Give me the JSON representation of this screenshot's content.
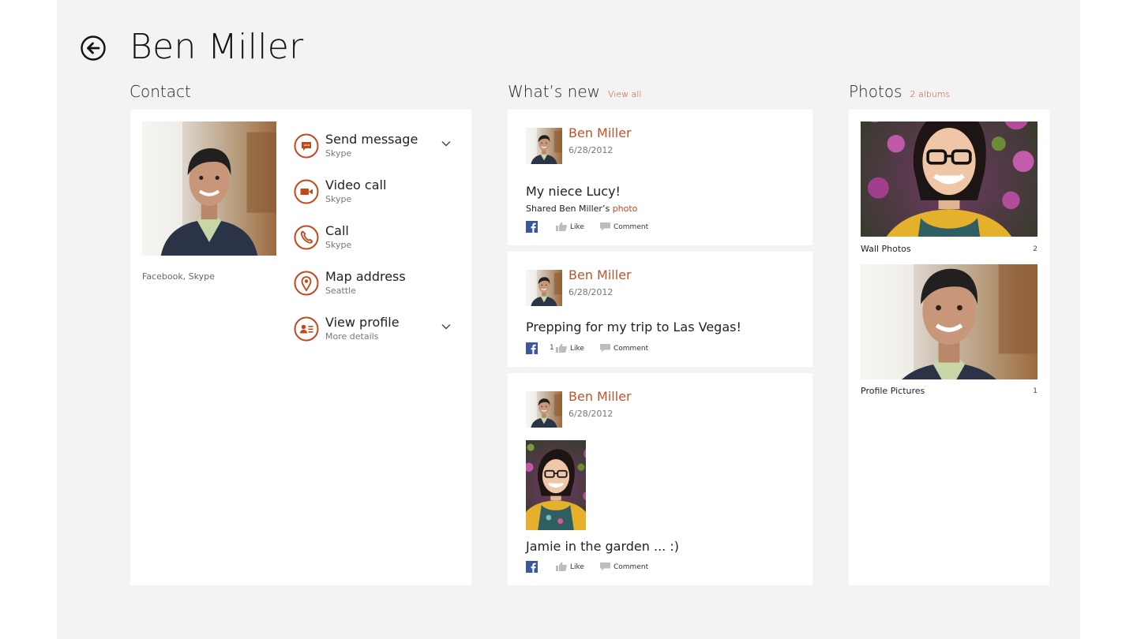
{
  "title": "Ben Miller",
  "contact": {
    "heading": "Contact",
    "sources": "Facebook, Skype",
    "actions": [
      {
        "label": "Send message",
        "sub": "Skype"
      },
      {
        "label": "Video call",
        "sub": "Skype"
      },
      {
        "label": "Call",
        "sub": "Skype"
      },
      {
        "label": "Map address",
        "sub": "Seattle"
      },
      {
        "label": "View profile",
        "sub": "More details"
      }
    ]
  },
  "whats_new": {
    "heading": "What’s new",
    "view_all": "View all",
    "posts": [
      {
        "name": "Ben Miller",
        "date": "6/28/2012",
        "text": "My niece Lucy!",
        "shared_prefix": "Shared Ben Miller’s",
        "shared_link": "photo",
        "likes": "",
        "like_label": "Like",
        "comment_label": "Comment"
      },
      {
        "name": "Ben Miller",
        "date": "6/28/2012",
        "text": "Prepping for my trip to Las Vegas!",
        "likes": "1",
        "like_label": "Like",
        "comment_label": "Comment"
      },
      {
        "name": "Ben Miller",
        "date": "6/28/2012",
        "text": "Jamie in the garden ... :)",
        "likes": "",
        "like_label": "Like",
        "comment_label": "Comment"
      }
    ]
  },
  "photos": {
    "heading": "Photos",
    "albums_link": "2 albums",
    "albums": [
      {
        "name": "Wall Photos",
        "count": "2"
      },
      {
        "name": "Profile Pictures",
        "count": "1"
      }
    ]
  },
  "colors": {
    "accent": "#c2481d",
    "name_link": "#b9552e",
    "background": "#f3f3f3",
    "facebook": "#3b5998"
  },
  "icons": [
    "back-arrow-icon",
    "message-icon",
    "video-icon",
    "phone-icon",
    "map-pin-icon",
    "profile-icon",
    "chevron-down-icon",
    "facebook-icon",
    "thumbs-up-icon",
    "comment-icon"
  ]
}
